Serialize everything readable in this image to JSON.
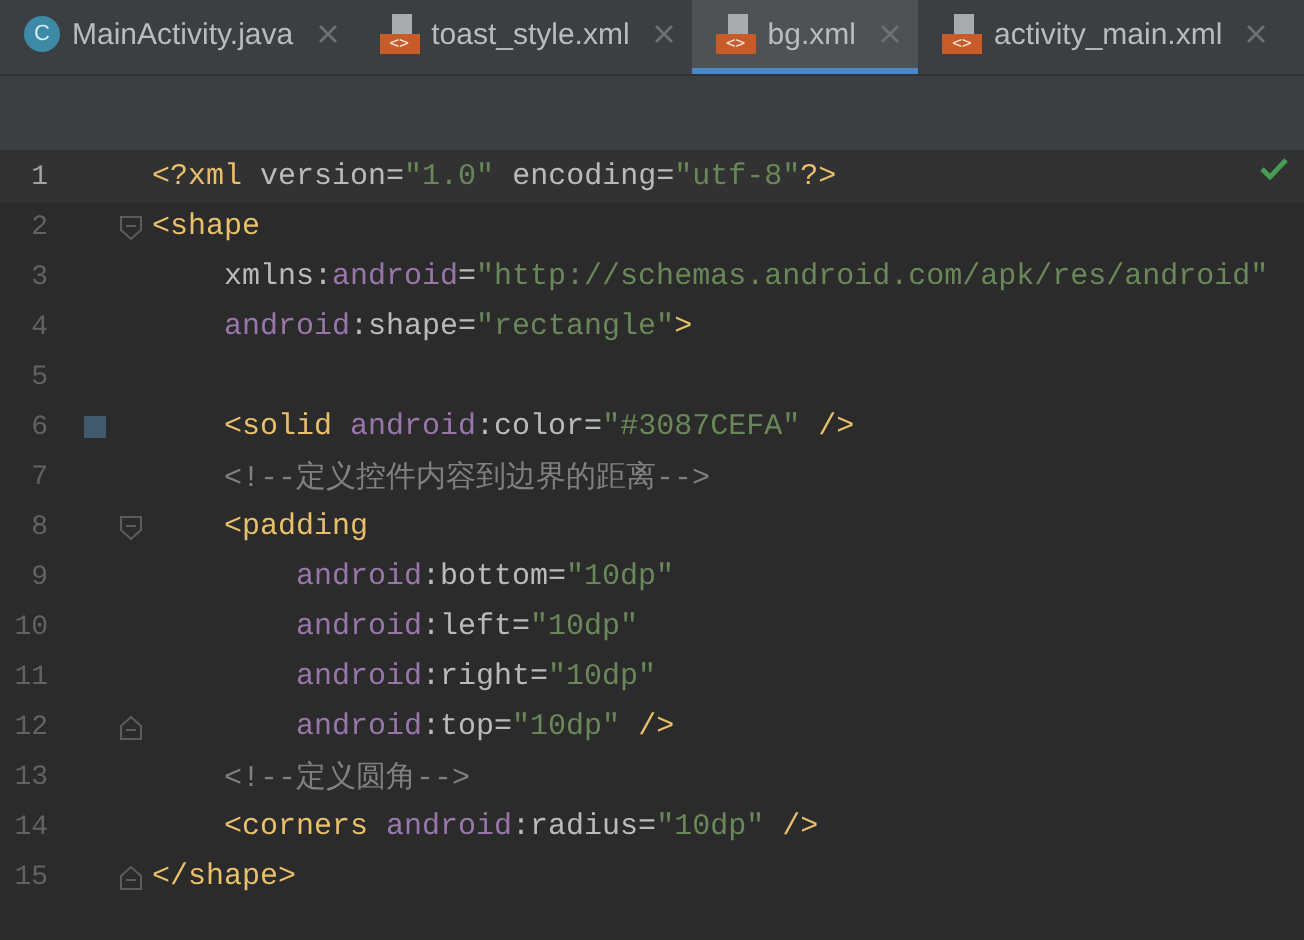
{
  "tabs": [
    {
      "label": "MainActivity.java",
      "kind": "java",
      "badge": "C",
      "selected": false
    },
    {
      "label": "toast_style.xml",
      "kind": "xml",
      "badge": "<>",
      "selected": false
    },
    {
      "label": "bg.xml",
      "kind": "xml",
      "badge": "<>",
      "selected": true
    },
    {
      "label": "activity_main.xml",
      "kind": "xml",
      "badge": "<>",
      "selected": false
    }
  ],
  "editor": {
    "inspection_ok": true,
    "lines": [
      {
        "number": "1",
        "current": true,
        "fold_start": false,
        "fold_end": false,
        "color_swatch": false,
        "tokens": [
          {
            "tag": "<?xml "
          },
          {
            "plain": "version"
          },
          {
            "plain": "="
          },
          {
            "str": "\"1.0\""
          },
          {
            "plain": " encoding"
          },
          {
            "plain": "="
          },
          {
            "str": "\"utf-8\""
          },
          {
            "tag": "?>"
          }
        ]
      },
      {
        "number": "2",
        "current": false,
        "fold_start": true,
        "fold_end": false,
        "color_swatch": false,
        "tokens": [
          {
            "tag": "<shape"
          }
        ]
      },
      {
        "number": "3",
        "current": false,
        "fold_start": false,
        "fold_end": false,
        "color_swatch": false,
        "tokens": [
          {
            "plain": "    xmlns:"
          },
          {
            "ns": "android"
          },
          {
            "plain": "="
          },
          {
            "str": "\"http://schemas.android.com/apk/res/android\""
          }
        ]
      },
      {
        "number": "4",
        "current": false,
        "fold_start": false,
        "fold_end": false,
        "color_swatch": false,
        "tokens": [
          {
            "ns": "    android"
          },
          {
            "plain": ":shape="
          },
          {
            "str": "\"rectangle\""
          },
          {
            "tag": ">"
          }
        ]
      },
      {
        "number": "5",
        "current": false,
        "fold_start": false,
        "fold_end": false,
        "color_swatch": false
      },
      {
        "number": "6",
        "current": false,
        "fold_start": false,
        "fold_end": false,
        "color_swatch": true,
        "tokens": [
          {
            "tag": "    <solid "
          },
          {
            "ns": "android"
          },
          {
            "plain": ":color="
          },
          {
            "str": "\"#3087CEFA\""
          },
          {
            "tag": " />"
          }
        ]
      },
      {
        "number": "7",
        "current": false,
        "fold_start": false,
        "fold_end": false,
        "color_swatch": false,
        "tokens": [
          {
            "comment": "    <!--定义控件内容到边界的距离-->"
          }
        ]
      },
      {
        "number": "8",
        "current": false,
        "fold_start": true,
        "fold_end": false,
        "color_swatch": false,
        "tokens": [
          {
            "tag": "    <padding"
          }
        ]
      },
      {
        "number": "9",
        "current": false,
        "fold_start": false,
        "fold_end": false,
        "color_swatch": false,
        "tokens": [
          {
            "ns": "        android"
          },
          {
            "plain": ":bottom="
          },
          {
            "str": "\"10dp\""
          }
        ]
      },
      {
        "number": "10",
        "current": false,
        "fold_start": false,
        "fold_end": false,
        "color_swatch": false,
        "tokens": [
          {
            "ns": "        android"
          },
          {
            "plain": ":left="
          },
          {
            "str": "\"10dp\""
          }
        ]
      },
      {
        "number": "11",
        "current": false,
        "fold_start": false,
        "fold_end": false,
        "color_swatch": false,
        "tokens": [
          {
            "ns": "        android"
          },
          {
            "plain": ":right="
          },
          {
            "str": "\"10dp\""
          }
        ]
      },
      {
        "number": "12",
        "current": false,
        "fold_start": false,
        "fold_end": true,
        "color_swatch": false,
        "tokens": [
          {
            "ns": "        android"
          },
          {
            "plain": ":top="
          },
          {
            "str": "\"10dp\""
          },
          {
            "tag": " />"
          }
        ]
      },
      {
        "number": "13",
        "current": false,
        "fold_start": false,
        "fold_end": false,
        "color_swatch": false,
        "tokens": [
          {
            "comment": "    <!--定义圆角-->"
          }
        ]
      },
      {
        "number": "14",
        "current": false,
        "fold_start": false,
        "fold_end": false,
        "color_swatch": false,
        "tokens": [
          {
            "tag": "    <corners "
          },
          {
            "ns": "android"
          },
          {
            "plain": ":radius="
          },
          {
            "str": "\"10dp\""
          },
          {
            "tag": " />"
          }
        ]
      },
      {
        "number": "15",
        "current": false,
        "fold_start": false,
        "fold_end": true,
        "color_swatch": false,
        "tokens": [
          {
            "tag": "</shape>"
          }
        ]
      }
    ]
  }
}
